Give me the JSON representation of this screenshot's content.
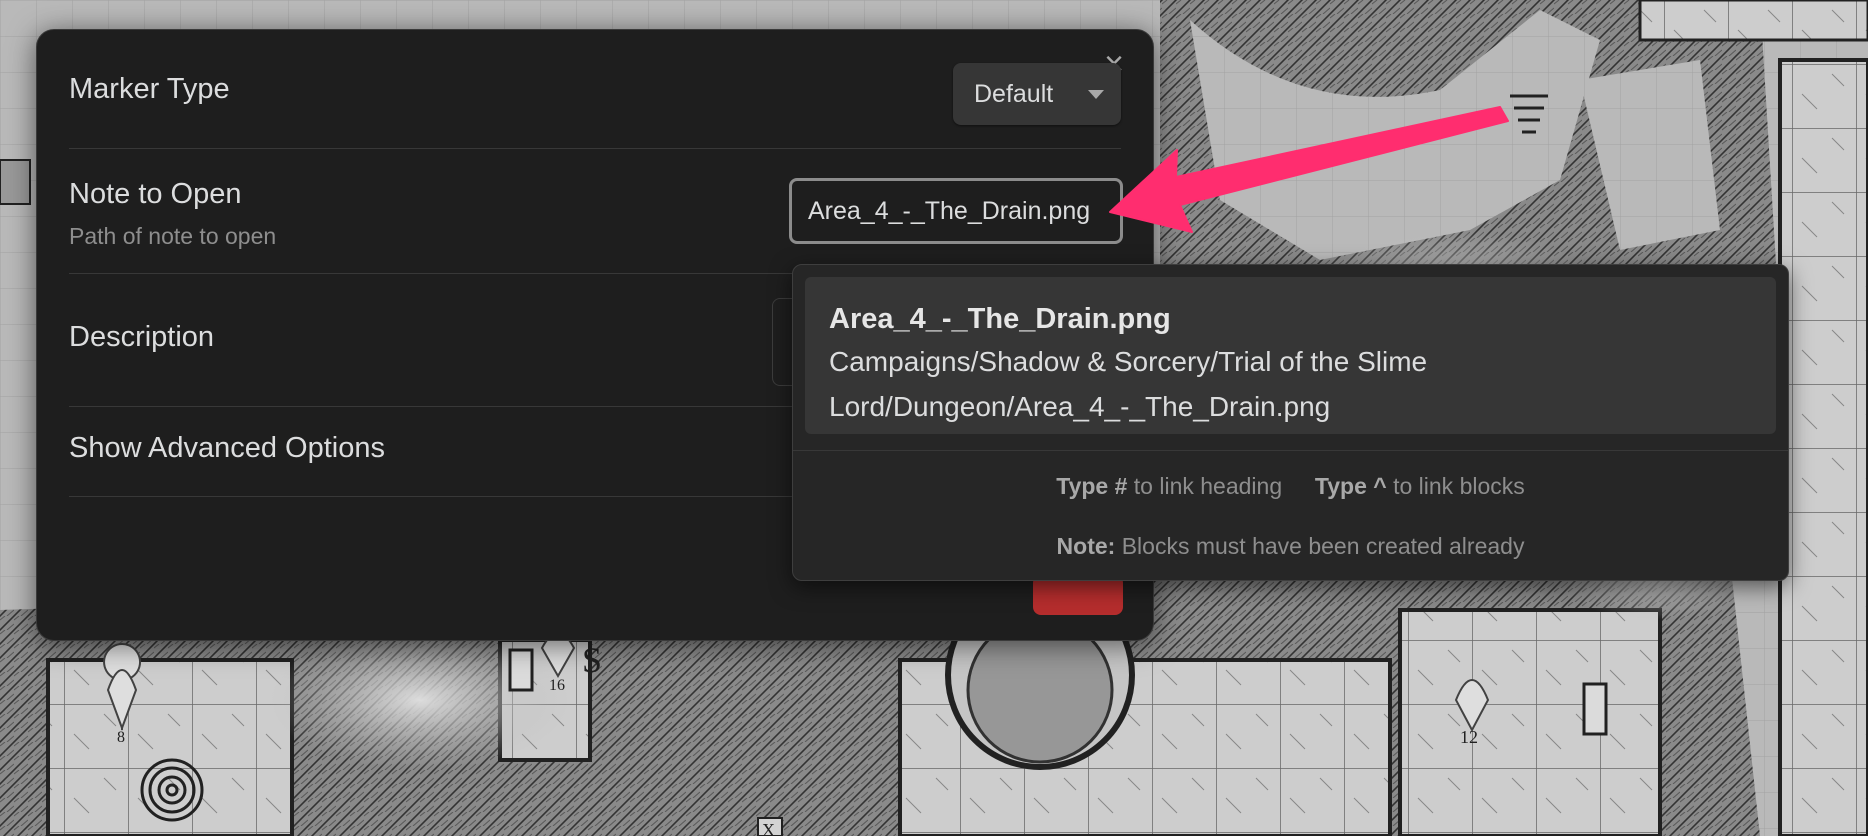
{
  "modal": {
    "close_symbol": "×",
    "marker_type": {
      "label": "Marker Type",
      "selected": "Default"
    },
    "note_to_open": {
      "label": "Note to Open",
      "description": "Path of note to open",
      "value": "Area_4_-_The_Drain.png"
    },
    "description": {
      "label": "Description"
    },
    "advanced": {
      "label": "Show Advanced Options"
    }
  },
  "suggestion": {
    "title": "Area_4_-_The_Drain.png",
    "path": "Campaigns/Shadow & Sorcery/Trial of the Slime Lord/Dungeon/Area_4_-_The_Drain.png",
    "instructions": [
      {
        "command": "Type #",
        "purpose": "to link heading"
      },
      {
        "command": "Type ^",
        "purpose": "to link blocks"
      },
      {
        "command": "Note:",
        "purpose": "Blocks must have been created already"
      }
    ]
  },
  "map_markers": [
    "8",
    "16",
    "12"
  ],
  "map_labels": [
    "S",
    "X"
  ],
  "colors": {
    "modal_bg": "#1e1e1e",
    "popover_bg": "#262626",
    "selected_item_bg": "#363636",
    "arrow": "#ff2d6f",
    "map_bg": "#b9b9b9"
  }
}
